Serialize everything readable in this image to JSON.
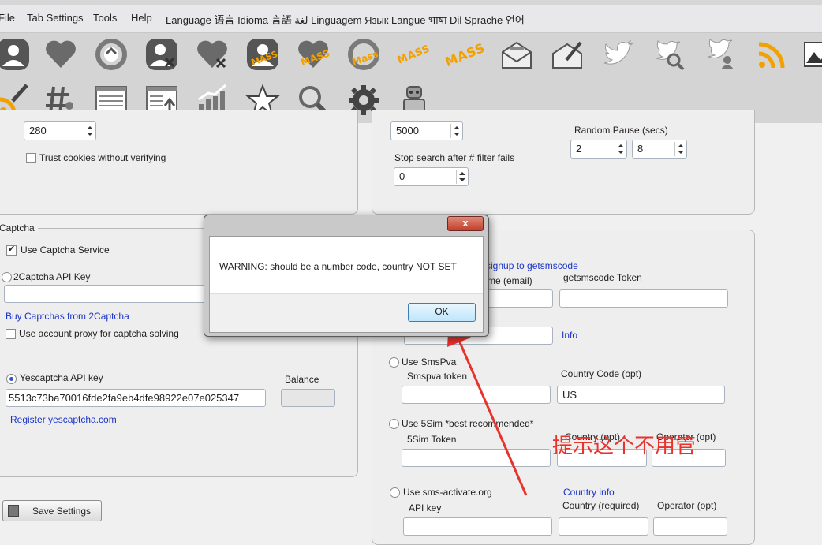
{
  "menu": {
    "file": "File",
    "tab_settings": "Tab Settings",
    "tools": "Tools",
    "help": "Help",
    "language": "Language 语言 Idioma 言語 لغة Linguagem Язык Langue भाषा Dil Sprache 언어"
  },
  "toolbar": {
    "row1": [
      "user-icon",
      "heart-icon",
      "retweet-icon",
      "user-remove-icon",
      "heart-remove-icon",
      "mass-user-icon",
      "mass-heart-icon",
      "mass-retweet-icon",
      "mass-label",
      "mass-label",
      "mail-open-icon",
      "mail-edit-icon",
      "twitter-bird-icon",
      "twitter-search-icon",
      "twitter-users-icon",
      "rss-icon",
      "image-icon"
    ],
    "row2": [
      "rss-edit-icon",
      "hashtag-user-icon",
      "list-icon",
      "upload-list-icon",
      "stats-chart-icon",
      "star-icon",
      "magnifier-icon",
      "gear-icon",
      "robot-icon"
    ],
    "mass_label": "MASS"
  },
  "top_left": {
    "number_value": "280",
    "trust_cookies_label": "Trust cookies without verifying"
  },
  "top_right": {
    "number_value": "5000",
    "random_pause_label": "Random Pause (secs)",
    "pause_min": "2",
    "pause_max": "8",
    "stop_search_label": "Stop search after # filter fails",
    "stop_search_value": "0"
  },
  "captcha": {
    "group_label": "Captcha",
    "use_service_label": "Use Captcha Service",
    "twocaptcha_label": "2Captcha API Key",
    "twocaptcha_value": "",
    "buy_link": "Buy Captchas from 2Captcha",
    "use_proxy_label": "Use account proxy for captcha solving",
    "yescaptcha_label": "Yescaptcha API key",
    "yescaptcha_value": "5513c73ba70016fde2fa9eb4dfe98922e07e025347",
    "balance_label": "Balance",
    "balance_value": "",
    "register_link": "Register yescaptcha.com"
  },
  "sms": {
    "signup_link": "signup to getsmscode",
    "username_label": "me (email)",
    "token_label": "getsmscode Token",
    "info_link": "Info",
    "smspva_label": "Use SmsPva",
    "smspva_token_label": "Smspva token",
    "country_code_label": "Country Code  (opt)",
    "country_code_value": "US",
    "fivesim_label": "Use 5Sim *best recommended*",
    "fivesim_token_label": "5Sim Token",
    "country_opt_label": "Country (opt)",
    "operator_opt_label": "Operator (opt)",
    "smsactivate_label": "Use sms-activate.org",
    "country_info_link": "Country info",
    "api_key_label": "API key",
    "country_required_label": "Country (required)",
    "operator_label": "Operator  (opt)"
  },
  "save_button": "Save Settings",
  "dialog": {
    "message": "WARNING:  should be a number code, country NOT SET",
    "ok_label": "OK",
    "close_label": "x"
  },
  "annotation": {
    "text": "提示这个不用管",
    "color": "#e8322c"
  }
}
